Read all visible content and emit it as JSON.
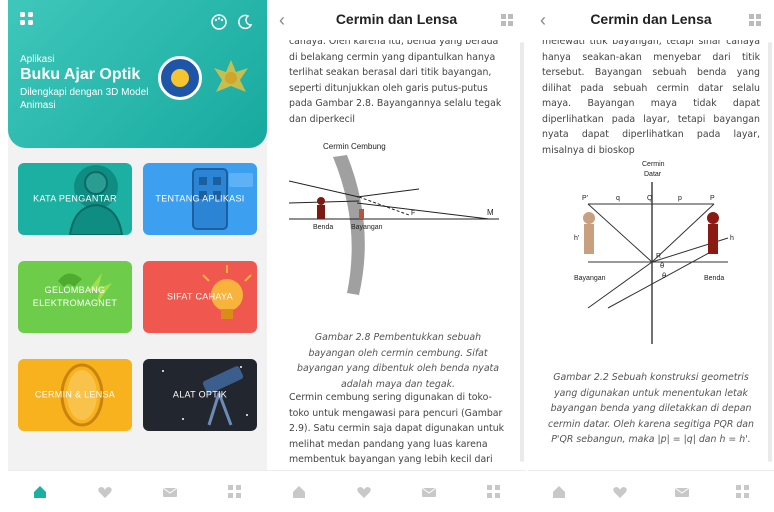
{
  "home": {
    "subtitle": "Aplikasi",
    "title": "Buku Ajar Optik",
    "description": "Dilengkapi dengan 3D Model Animasi",
    "menu": [
      {
        "label": "KATA PENGANTAR",
        "color": "#1bb0a1"
      },
      {
        "label": "TENTANG APLIKASI",
        "color": "#3d9ff0"
      },
      {
        "label": "GELOMBANG ELEKTROMAGNET",
        "color": "#6dcd4b"
      },
      {
        "label": "SIFAT CAHAYA",
        "color": "#f0584f"
      },
      {
        "label": "CERMIN & LENSA",
        "color": "#f7b21e"
      },
      {
        "label": "ALAT OPTIK",
        "color": "#22262e"
      }
    ],
    "accent": "#1bb0a1"
  },
  "page2": {
    "title": "Cermin dan Lensa",
    "intro": "cahaya. Oleh karena itu, benda yang berada di belakang cermin yang dipantulkan hanya terlihat seakan berasal dari titik bayangan, seperti ditunjukkan oleh garis putus-putus pada Gambar 2.8. Bayangannya selalu tegak dan diperkecil",
    "diagram": {
      "mirror_label": "Cermin Cembung",
      "object_label": "Benda",
      "image_label": "Bayangan",
      "f_label": "F",
      "m_label": "M"
    },
    "caption": "Gambar 2.8 Pembentukkan sebuah bayangan oleh cermin cembung. Sifat bayangan yang dibentuk oleh benda nyata adalah maya dan tegak.",
    "after": "Cermin cembung sering digunakan di toko-toko untuk mengawasi para pencuri (Gambar 2.9). Satu cermin saja dapat digunakan untuk melihat medan pandang yang luas karena membentuk bayangan yang lebih kecil dari bagian dalam toko."
  },
  "page3": {
    "title": "Cermin dan Lensa",
    "intro": "melewati titik bayangan, tetapi sinar cahaya hanya seakan-akan menyebar dari titik tersebut. Bayangan sebuah benda yang dilihat pada sebuah cermin datar selalu maya. Bayangan maya tidak dapat diperlihatkan pada layar, tetapi bayangan nyata dapat diperlihatkan pada layar, misalnya di bioskop",
    "diagram": {
      "mirror_label_1": "Cermin",
      "mirror_label_2": "Datar",
      "p_prime": "P'",
      "q_lower": "q",
      "q_upper": "Q",
      "p_lower": "p",
      "p_upper": "P",
      "h_prime": "h'",
      "h": "h",
      "r": "R",
      "theta1": "θ",
      "theta2": "θ",
      "image_label": "Bayangan",
      "object_label": "Benda"
    },
    "caption": "Gambar 2.2 Sebuah konstruksi geometris yang digunakan untuk menentukan letak bayangan benda yang diletakkan di depan cermin datar. Oleh karena segitiga PQR dan P'QR sebangun, maka |p| = |q| dan h = h'."
  }
}
